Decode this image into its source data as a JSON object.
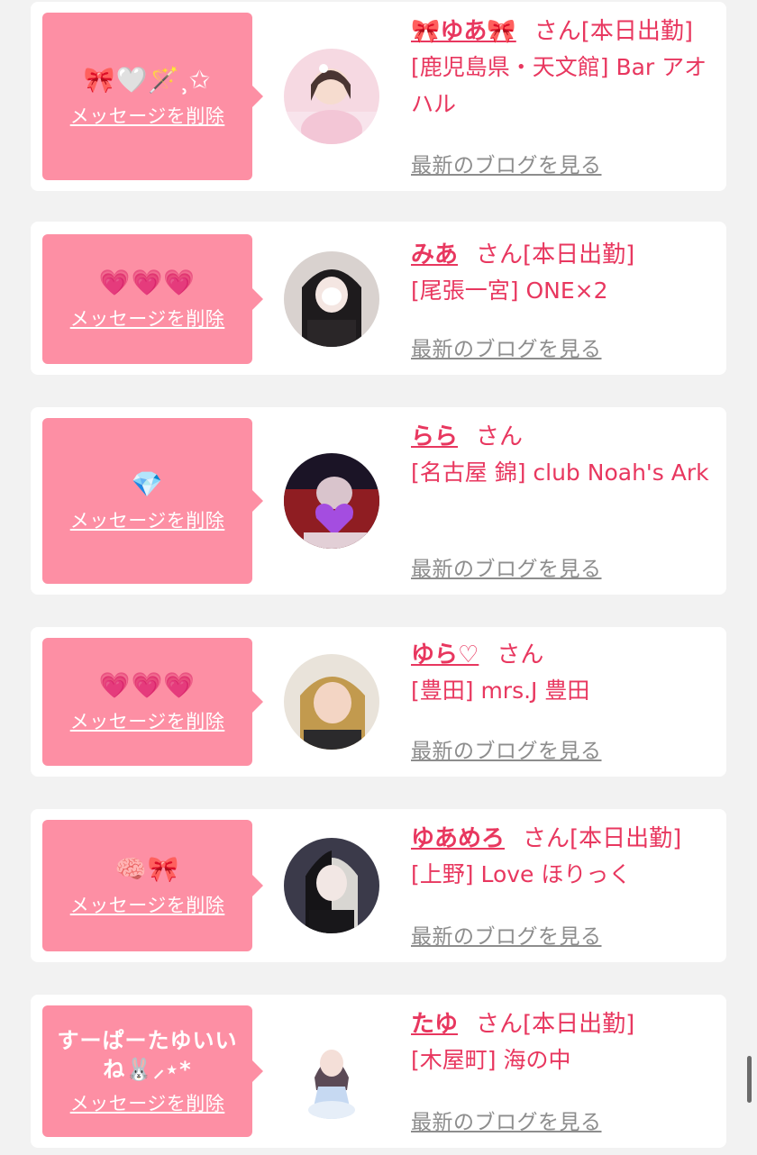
{
  "favorites": [
    {
      "message": "🎀🤍🪄⸒✩",
      "delete_label": "メッセージを削除",
      "name": "🎀ゆあ🎀",
      "honorific": "さん",
      "status": "[本日出勤]",
      "shop": "[鹿児島県・天文館] Bar アオハル",
      "blog_label": "最新のブログを見る"
    },
    {
      "message": "💗💗💗",
      "delete_label": "メッセージを削除",
      "name": "みあ",
      "honorific": "さん",
      "status": "[本日出勤]",
      "shop": "[尾張一宮] ONE×2",
      "blog_label": "最新のブログを見る"
    },
    {
      "message": "💎",
      "delete_label": "メッセージを削除",
      "name": "らら",
      "honorific": "さん",
      "status": "",
      "shop": "[名古屋 錦] club Noah's Ark",
      "blog_label": "最新のブログを見る"
    },
    {
      "message": "💗💗💗",
      "delete_label": "メッセージを削除",
      "name": "ゆら♡",
      "honorific": "さん",
      "status": "",
      "shop": "[豊田] mrs.J 豊田",
      "blog_label": "最新のブログを見る"
    },
    {
      "message": "🧠🎀",
      "delete_label": "メッセージを削除",
      "name": "ゆあめろ",
      "honorific": "さん",
      "status": "[本日出勤]",
      "shop": "[上野] Love ほりっく",
      "blog_label": "最新のブログを見る"
    },
    {
      "message": "すーぱーたゆいいね🐰⸝⋆*",
      "delete_label": "メッセージを削除",
      "name": "たゆ",
      "honorific": "さん",
      "status": "[本日出勤]",
      "shop": "[木屋町] 海の中",
      "blog_label": "最新のブログを見る"
    }
  ],
  "colors": {
    "page_bg": "#f2f2f2",
    "card_bg": "#ffffff",
    "bubble_bg": "#fd8fa4",
    "accent_text": "#e8375f",
    "blog_link": "#8d8d8d"
  }
}
